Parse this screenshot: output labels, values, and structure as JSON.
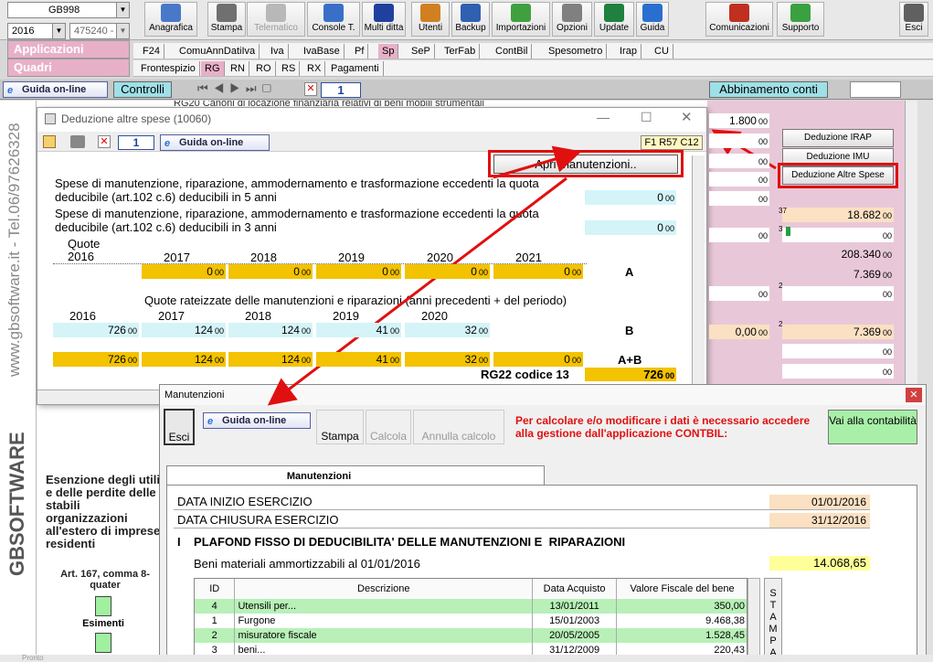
{
  "top": {
    "company": "GB998",
    "year": "2016",
    "code": "475240 -",
    "applicazioni": "Applicazioni",
    "quadri": "Quadri"
  },
  "toolbar": [
    {
      "label": "Anagrafica",
      "color": "#4a78c8"
    },
    {
      "label": "Stampa",
      "color": "#707070"
    },
    {
      "label": "Telematico",
      "color": "#b8b8b8"
    },
    {
      "label": "Console T.",
      "color": "#3a6fc8"
    },
    {
      "label": "Multi ditta",
      "color": "#2040a0"
    },
    {
      "label": "Utenti",
      "color": "#d08020"
    },
    {
      "label": "Backup",
      "color": "#3060b0"
    },
    {
      "label": "Importazioni",
      "color": "#40a040"
    },
    {
      "label": "Opzioni",
      "color": "#808080"
    },
    {
      "label": "Update",
      "color": "#208040"
    },
    {
      "label": "Guida",
      "color": "#2a6fd0"
    },
    {
      "label": "Comunicazioni",
      "color": "#c03020"
    },
    {
      "label": "Supporto",
      "color": "#3aa040"
    },
    {
      "label": "Esci",
      "color": "#606060"
    }
  ],
  "apptabs": [
    "F24",
    "ComuAnnDatiIva",
    "Iva",
    "IvaBase",
    "Pf",
    "Sp",
    "SeP",
    "TerFab",
    "ContBil",
    "Spesometro",
    "Irap",
    "CU"
  ],
  "quadritabs": [
    "Frontespizio",
    "RG",
    "RN",
    "RO",
    "RS",
    "RX",
    "Pagamenti"
  ],
  "nav": {
    "guida": "Guida on-line",
    "controlli": "Controlli",
    "page": "1",
    "abbinamento": "Abbinamento conti",
    "rg_title": "RG20  Canoni di locazione finanziaria relativi di beni mobili strumentali"
  },
  "background": {
    "values": [
      "1.800",
      "18.682",
      "208.340",
      "7.369",
      "7.369",
      "0,00"
    ],
    "cents": "00",
    "btn_irap": "Deduzione IRAP",
    "btn_imu": "Deduzione IMU",
    "btn_altre": "Deduzione Altre Spese",
    "n37": "37",
    "n3": "3",
    "n2": "2"
  },
  "side": {
    "url": "www.gbsoftware.it - Tel.06/97626328",
    "brand": "GBSOFTWARE",
    "esenzione": "Esenzione degli utili e delle perdite delle stabili organizzazioni all'estero di imprese residenti",
    "art": "Art. 167, comma 8-quater",
    "esimenti": "Esimenti"
  },
  "ded": {
    "title": "Deduzione altre spese (10060)",
    "page": "1",
    "guida": "Guida on-line",
    "code": "F1 R57 C12",
    "apri": "Apri manutenzioni..",
    "text1": "Spese di manutenzione, riparazione, ammodernamento e trasformazione eccedenti la quota deducibile (art.102 c.6) deducibili in 5 anni",
    "text2": "Spese di manutenzione, riparazione, ammodernamento e trasformazione eccedenti la quota deducibile (art.102 c.6) deducibili in 3 anni",
    "v1": "0",
    "v2": "0",
    "cents": "00",
    "quote": "Quote",
    "years1": [
      "2016",
      "2017",
      "2018",
      "2019",
      "2020",
      "2021"
    ],
    "rowA": [
      "0",
      "0",
      "0",
      "0",
      "0"
    ],
    "labA": "A",
    "rate_title": "Quote rateizzate delle manutenzioni e riparazioni (anni precedenti + del periodo)",
    "years2": [
      "2016",
      "2017",
      "2018",
      "2019",
      "2020"
    ],
    "rowB": [
      "726",
      "124",
      "124",
      "41",
      "32"
    ],
    "labB": "B",
    "rowAB": [
      "726",
      "124",
      "124",
      "41",
      "32",
      "0"
    ],
    "labAB": "A+B",
    "rg22": "RG22 codice 13",
    "rg22v": "726"
  },
  "man": {
    "title": "Manutenzioni",
    "esci": "Esci",
    "guida": "Guida on-line",
    "stampa": "Stampa",
    "calcola": "Calcola",
    "annulla": "Annulla calcolo",
    "warn": "Per calcolare e/o modificare i dati è necessario accedere alla gestione dall'applicazione CONTBIL:",
    "vai": "Vai alla contabilità",
    "tab": "Manutenzioni",
    "inizio_l": "DATA INIZIO ESERCIZIO",
    "inizio": "01/01/2016",
    "chiusura_l": "DATA CHIUSURA ESERCIZIO",
    "chiusura": "31/12/2016",
    "sect": "I    PLAFOND FISSO DI DEDUCIBILITA' DELLE MANUTENZIONI E  RIPARAZIONI",
    "beni_l": "Beni materiali ammortizzabili al 01/01/2016",
    "beni": "14.068,65",
    "cols": [
      "ID",
      "Descrizione",
      "Data Acquisto",
      "Valore Fiscale del bene"
    ],
    "rows": [
      {
        "id": "4",
        "d": "Utensili per...",
        "a": "13/01/2011",
        "v": "350,00"
      },
      {
        "id": "1",
        "d": "Furgone",
        "a": "15/01/2003",
        "v": "9.468,38"
      },
      {
        "id": "2",
        "d": "misuratore fiscale",
        "a": "20/05/2005",
        "v": "1.528,45"
      },
      {
        "id": "3",
        "d": "beni...",
        "a": "31/12/2009",
        "v": "220,43"
      }
    ],
    "stampa_v": "STAMPA"
  },
  "status": "Pronto"
}
